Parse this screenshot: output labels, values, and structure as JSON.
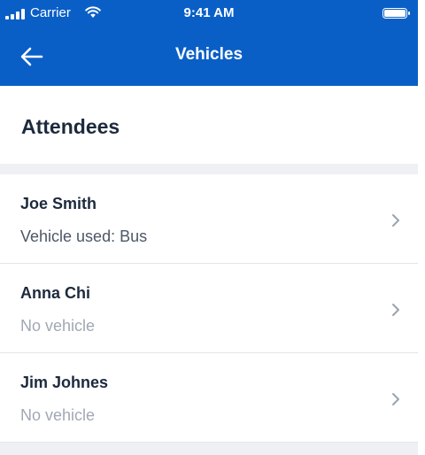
{
  "status_bar": {
    "carrier": "Carrier",
    "time": "9:41 AM"
  },
  "nav": {
    "title": "Vehicles",
    "back_icon": "arrow-left-icon"
  },
  "section": {
    "title": "Attendees"
  },
  "attendees": [
    {
      "name": "Joe Smith",
      "vehicle": "Vehicle used: Bus",
      "has_vehicle": true
    },
    {
      "name": "Anna Chi",
      "vehicle": "No vehicle",
      "has_vehicle": false
    },
    {
      "name": "Jim Johnes",
      "vehicle": "No vehicle",
      "has_vehicle": false
    }
  ],
  "colors": {
    "header_bg": "#0a5fc7",
    "title_text": "#1d2a3d",
    "secondary_text": "#4d5768",
    "muted_text": "#a1a8b4",
    "chevron": "#9aa3b0",
    "page_bg": "#eff0f4"
  }
}
